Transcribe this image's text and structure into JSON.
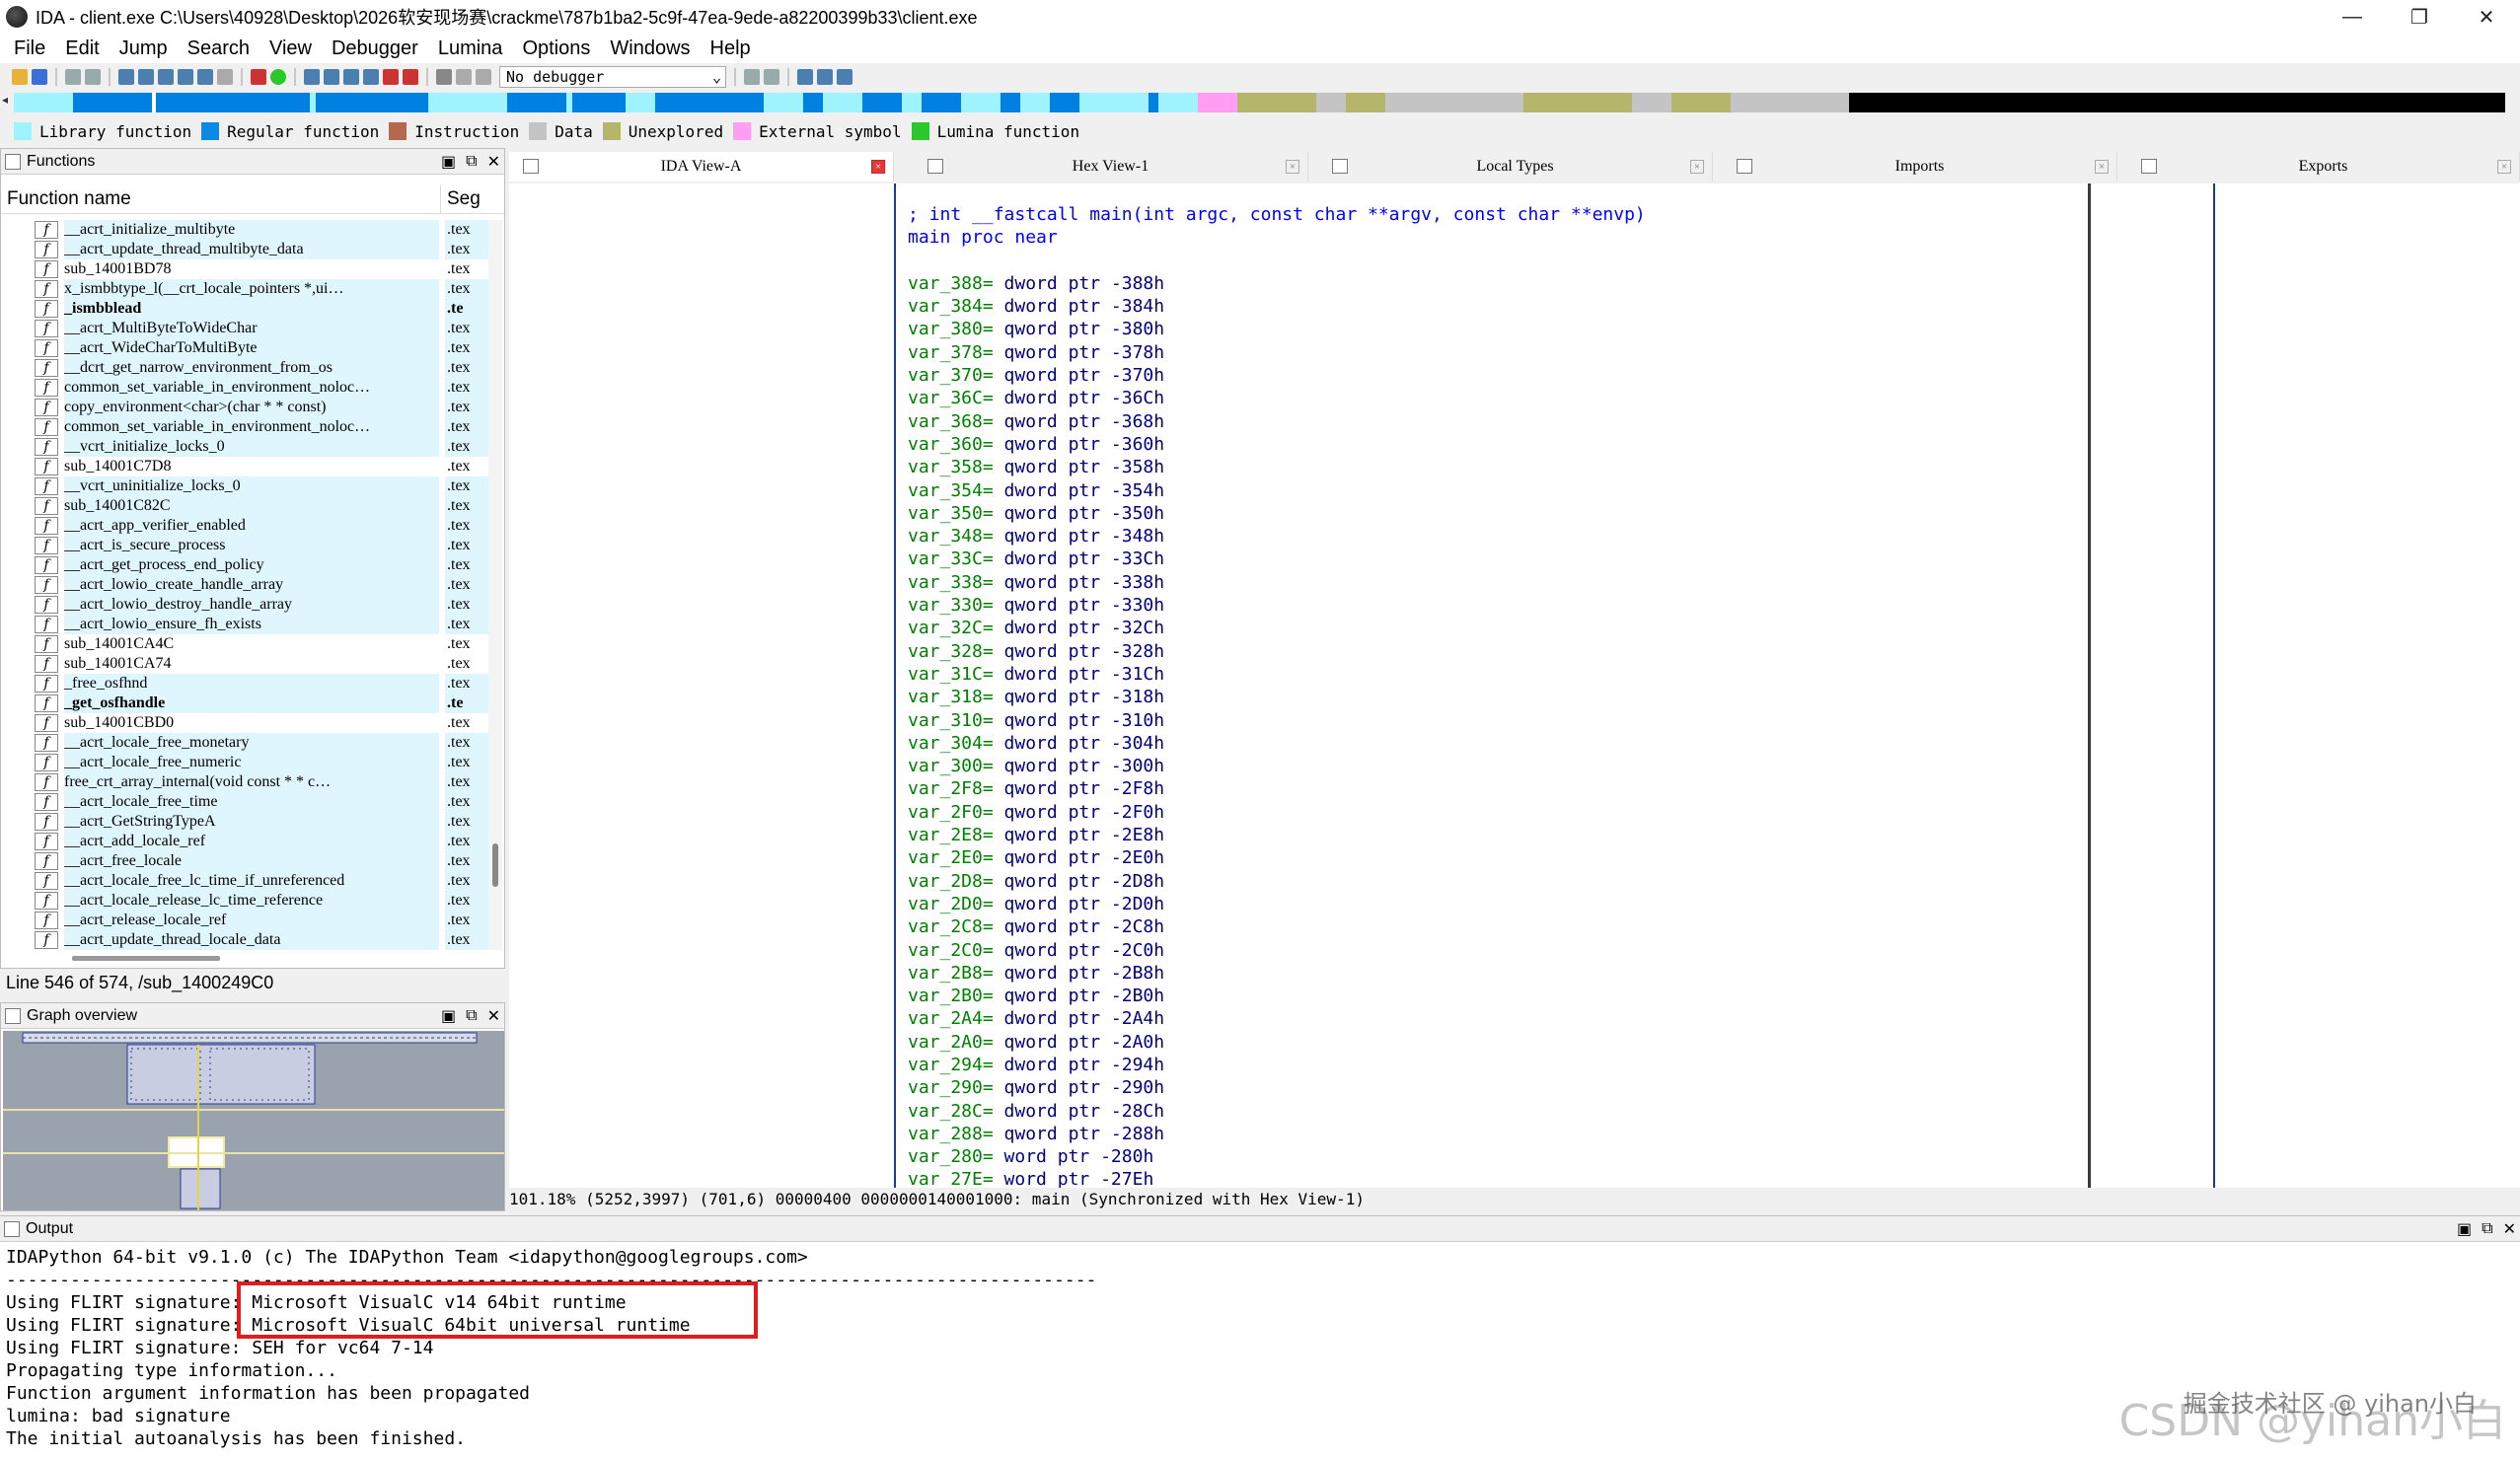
{
  "window": {
    "title": "IDA - client.exe C:\\Users\\40928\\Desktop\\2026软安现场赛\\crackme\\787b1ba2-5c9f-47ea-9ede-a82200399b33\\client.exe",
    "minimize": "—",
    "maximize": "❐",
    "close": "✕"
  },
  "menu": [
    "File",
    "Edit",
    "Jump",
    "Search",
    "View",
    "Debugger",
    "Lumina",
    "Options",
    "Windows",
    "Help"
  ],
  "toolbar": {
    "debugger_select": "No debugger"
  },
  "legend": [
    {
      "label": "Library function",
      "color": "#9ff3ff"
    },
    {
      "label": "Regular function",
      "color": "#0a8ae6"
    },
    {
      "label": "Instruction",
      "color": "#b5684f"
    },
    {
      "label": "Data",
      "color": "#c4c4c4"
    },
    {
      "label": "Unexplored",
      "color": "#b5b56b"
    },
    {
      "label": "External symbol",
      "color": "#ff9ef2"
    },
    {
      "label": "Lumina function",
      "color": "#2bc72b"
    }
  ],
  "functions": {
    "title": "Functions",
    "col_name": "Function name",
    "col_seg": "Seg",
    "rows": [
      {
        "name": "__acrt_initialize_multibyte",
        "seg": ".tex"
      },
      {
        "name": "__acrt_update_thread_multibyte_data",
        "seg": ".tex"
      },
      {
        "name": "sub_14001BD78",
        "seg": ".tex"
      },
      {
        "name": "x_ismbbtype_l(__crt_locale_pointers *,ui…",
        "seg": ".tex"
      },
      {
        "name": "_ismbblead",
        "seg": ".te",
        "bold": true
      },
      {
        "name": "__acrt_MultiByteToWideChar",
        "seg": ".tex"
      },
      {
        "name": "__acrt_WideCharToMultiByte",
        "seg": ".tex"
      },
      {
        "name": "__dcrt_get_narrow_environment_from_os",
        "seg": ".tex"
      },
      {
        "name": "common_set_variable_in_environment_noloc…",
        "seg": ".tex"
      },
      {
        "name": "copy_environment<char>(char * * const)",
        "seg": ".tex"
      },
      {
        "name": "common_set_variable_in_environment_noloc…",
        "seg": ".tex"
      },
      {
        "name": "__vcrt_initialize_locks_0",
        "seg": ".tex"
      },
      {
        "name": "sub_14001C7D8",
        "seg": ".tex"
      },
      {
        "name": "__vcrt_uninitialize_locks_0",
        "seg": ".tex"
      },
      {
        "name": "sub_14001C82C",
        "seg": ".tex"
      },
      {
        "name": "__acrt_app_verifier_enabled",
        "seg": ".tex"
      },
      {
        "name": "__acrt_is_secure_process",
        "seg": ".tex"
      },
      {
        "name": "__acrt_get_process_end_policy",
        "seg": ".tex"
      },
      {
        "name": "__acrt_lowio_create_handle_array",
        "seg": ".tex"
      },
      {
        "name": "__acrt_lowio_destroy_handle_array",
        "seg": ".tex"
      },
      {
        "name": "__acrt_lowio_ensure_fh_exists",
        "seg": ".tex"
      },
      {
        "name": "sub_14001CA4C",
        "seg": ".tex"
      },
      {
        "name": "sub_14001CA74",
        "seg": ".tex"
      },
      {
        "name": "_free_osfhnd",
        "seg": ".tex"
      },
      {
        "name": "_get_osfhandle",
        "seg": ".te",
        "bold": true
      },
      {
        "name": "sub_14001CBD0",
        "seg": ".tex"
      },
      {
        "name": "__acrt_locale_free_monetary",
        "seg": ".tex"
      },
      {
        "name": "__acrt_locale_free_numeric",
        "seg": ".tex"
      },
      {
        "name": "free_crt_array_internal(void const * * c…",
        "seg": ".tex"
      },
      {
        "name": "__acrt_locale_free_time",
        "seg": ".tex"
      },
      {
        "name": "__acrt_GetStringTypeA",
        "seg": ".tex"
      },
      {
        "name": "__acrt_add_locale_ref",
        "seg": ".tex"
      },
      {
        "name": "__acrt_free_locale",
        "seg": ".tex"
      },
      {
        "name": "__acrt_locale_free_lc_time_if_unreferenced",
        "seg": ".tex"
      },
      {
        "name": "__acrt_locale_release_lc_time_reference",
        "seg": ".tex"
      },
      {
        "name": "__acrt_release_locale_ref",
        "seg": ".tex"
      },
      {
        "name": "__acrt_update_thread_locale_data",
        "seg": ".tex"
      }
    ]
  },
  "status_line": "Line 546 of 574, /sub_1400249C0",
  "graph_overview": {
    "title": "Graph overview"
  },
  "tabs": [
    {
      "label": "IDA View-A",
      "active": true
    },
    {
      "label": "Hex View-1"
    },
    {
      "label": "Local Types"
    },
    {
      "label": "Imports"
    },
    {
      "label": "Exports"
    }
  ],
  "code": {
    "comment": "; int __fastcall main(int argc, const char **argv, const char **envp)",
    "proc": "main proc near",
    "vars": [
      [
        "var_388",
        "dword",
        "-388h"
      ],
      [
        "var_384",
        "dword",
        "-384h"
      ],
      [
        "var_380",
        "qword",
        "-380h"
      ],
      [
        "var_378",
        "qword",
        "-378h"
      ],
      [
        "var_370",
        "qword",
        "-370h"
      ],
      [
        "var_36C",
        "dword",
        "-36Ch"
      ],
      [
        "var_368",
        "qword",
        "-368h"
      ],
      [
        "var_360",
        "qword",
        "-360h"
      ],
      [
        "var_358",
        "qword",
        "-358h"
      ],
      [
        "var_354",
        "dword",
        "-354h"
      ],
      [
        "var_350",
        "qword",
        "-350h"
      ],
      [
        "var_348",
        "qword",
        "-348h"
      ],
      [
        "var_33C",
        "dword",
        "-33Ch"
      ],
      [
        "var_338",
        "qword",
        "-338h"
      ],
      [
        "var_330",
        "qword",
        "-330h"
      ],
      [
        "var_32C",
        "dword",
        "-32Ch"
      ],
      [
        "var_328",
        "qword",
        "-328h"
      ],
      [
        "var_31C",
        "dword",
        "-31Ch"
      ],
      [
        "var_318",
        "qword",
        "-318h"
      ],
      [
        "var_310",
        "qword",
        "-310h"
      ],
      [
        "var_304",
        "dword",
        "-304h"
      ],
      [
        "var_300",
        "qword",
        "-300h"
      ],
      [
        "var_2F8",
        "qword",
        "-2F8h"
      ],
      [
        "var_2F0",
        "qword",
        "-2F0h"
      ],
      [
        "var_2E8",
        "qword",
        "-2E8h"
      ],
      [
        "var_2E0",
        "qword",
        "-2E0h"
      ],
      [
        "var_2D8",
        "qword",
        "-2D8h"
      ],
      [
        "var_2D0",
        "qword",
        "-2D0h"
      ],
      [
        "var_2C8",
        "qword",
        "-2C8h"
      ],
      [
        "var_2C0",
        "qword",
        "-2C0h"
      ],
      [
        "var_2B8",
        "qword",
        "-2B8h"
      ],
      [
        "var_2B0",
        "qword",
        "-2B0h"
      ],
      [
        "var_2A4",
        "dword",
        "-2A4h"
      ],
      [
        "var_2A0",
        "qword",
        "-2A0h"
      ],
      [
        "var_294",
        "dword",
        "-294h"
      ],
      [
        "var_290",
        "qword",
        "-290h"
      ],
      [
        "var_28C",
        "dword",
        "-28Ch"
      ],
      [
        "var_288",
        "qword",
        "-288h"
      ],
      [
        "var_280",
        "word",
        "-280h"
      ],
      [
        "var_27E",
        "word",
        "-27Eh"
      ]
    ]
  },
  "ida_status": "101.18% (5252,3997) (701,6) 00000400 0000000140001000: main (Synchronized with Hex View-1)",
  "output": {
    "title": "Output",
    "lines": [
      "IDAPython 64-bit v9.1.0 (c) The IDAPython Team <idapython@googlegroups.com>",
      "------------------------------------------------------------------------------------------------------",
      "Using FLIRT signature: Microsoft VisualC v14 64bit runtime",
      "Using FLIRT signature: Microsoft VisualC 64bit universal runtime",
      "Using FLIRT signature: SEH for vc64 7-14",
      "Propagating type information...",
      "Function argument information has been propagated",
      "lumina: bad signature",
      "The initial autoanalysis has been finished."
    ]
  },
  "watermark": {
    "big": "CSDN @yihan小白",
    "small": "掘金技术社区 @ yihan小白"
  }
}
